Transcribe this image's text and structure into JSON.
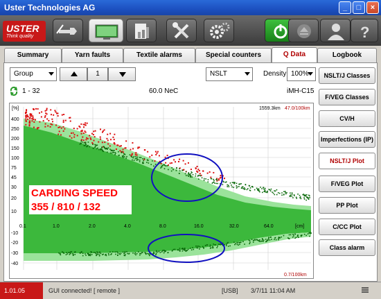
{
  "window": {
    "title": "Uster Technologies AG",
    "buttons": [
      "_",
      "□",
      "×"
    ]
  },
  "logo": {
    "name": "USTER",
    "tagline": "Think quality"
  },
  "toolbar": {
    "buttons": [
      {
        "icon": "yarn-path-icon",
        "selected": false
      },
      {
        "icon": "monitor-icon",
        "selected": true
      },
      {
        "icon": "report-chart-icon",
        "selected": false
      },
      {
        "icon": "tools-icon",
        "selected": false
      },
      {
        "icon": "gears-icon",
        "selected": false
      },
      {
        "icon": "power-icon",
        "selected": false
      },
      {
        "icon": "eject-icon",
        "selected": false
      },
      {
        "icon": "user-icon",
        "selected": false
      },
      {
        "icon": "help-icon",
        "selected": false
      }
    ]
  },
  "tabs": [
    {
      "label": "Summary"
    },
    {
      "label": "Yarn faults"
    },
    {
      "label": "Textile alarms"
    },
    {
      "label": "Special counters"
    },
    {
      "label": "Q Data",
      "active": true
    },
    {
      "label": "Logbook"
    }
  ],
  "controls": {
    "group_select": "Group",
    "page": "1",
    "class_select": "NSLT",
    "density_label": "Density",
    "density_select": "100%"
  },
  "info": {
    "range": "1 - 32",
    "count": "60.0 NeC",
    "machine": "iMH-C15"
  },
  "right_menu": [
    {
      "label": "NSLT/J Classes"
    },
    {
      "label": "F/VEG Classes"
    },
    {
      "label": "CV/H"
    },
    {
      "label": "Imperfections (IP)"
    },
    {
      "label": "NSLT/J Plot",
      "active": true
    },
    {
      "label": "F/VEG Plot"
    },
    {
      "label": "PP Plot"
    },
    {
      "label": "C/CC Plot"
    },
    {
      "label": "Class alarm"
    }
  ],
  "chart_data": {
    "type": "scatter",
    "y_unit": "[%]",
    "x_unit": "[cm]",
    "x_ticks": [
      "0.1",
      "1.0",
      "2.0",
      "4.0",
      "8.0",
      "16.0",
      "32.0",
      "64.0"
    ],
    "y_ticks_positive": [
      "400",
      "250",
      "200",
      "150",
      "100",
      "75",
      "45",
      "30",
      "20",
      "10"
    ],
    "y_ticks_negative": [
      "-10",
      "-20",
      "-30",
      "-40"
    ],
    "top_label_length": "1559.3km",
    "top_label_rate": "47.0/100km",
    "bottom_label_rate": "0.7/100km",
    "annotation_title": "CARDING SPEED",
    "annotation_values": "355 / 810 / 132",
    "colors": {
      "light_band": "#9be39b",
      "dark_band": "#3cb83c",
      "faults": "#dd1010",
      "dots": "#0a6a0a",
      "ellipse": "#1010c0",
      "annotation": "#ff0000"
    }
  },
  "statusbar": {
    "version": "1.01.05",
    "message": "GUI connected!  [ remote ]",
    "usb": "[USB]",
    "datetime": "3/7/11 11:04 AM"
  }
}
